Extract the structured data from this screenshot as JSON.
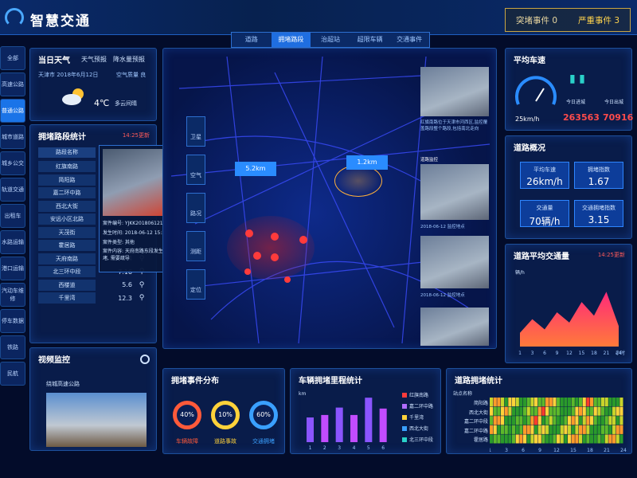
{
  "header": {
    "title": "智慧交通",
    "events": {
      "normal": "突堵事件 0",
      "severe": "严重事件 3"
    }
  },
  "tabs": [
    {
      "label": "道路"
    },
    {
      "label": "拥堵路段",
      "active": true
    },
    {
      "label": "治超站"
    },
    {
      "label": "超限车辆"
    },
    {
      "label": "交通事件"
    }
  ],
  "sidebar": {
    "items": [
      "全部",
      "高速公路",
      "普通公路",
      "城市道路",
      "城乡公交",
      "轨道交通",
      "出租车",
      "水路运输",
      "港口运输",
      "汽动车维修",
      "停车数据",
      "铁路",
      "民航"
    ],
    "active_index": 2
  },
  "weather": {
    "title": "当日天气",
    "tabs": [
      "天气预报",
      "降水量预报"
    ],
    "location_date": "天津市 2018年6月12日",
    "air": "空气质量 良",
    "temp": "4℃",
    "desc": "多云间晴"
  },
  "congestion_table": {
    "title": "拥堵路段统计",
    "updated": "14:25更新",
    "header": "路段名称",
    "rows": [
      {
        "name": "红旗南路"
      },
      {
        "name": "简阳路"
      },
      {
        "name": "嘉二环中路"
      },
      {
        "name": "西北大街"
      },
      {
        "name": "安远小区北路"
      },
      {
        "name": "天茂街"
      },
      {
        "name": "霍居路"
      },
      {
        "name": "天府南路",
        "value": "9.4"
      },
      {
        "name": "北三环中段",
        "value": "7.16"
      },
      {
        "name": "西楼道",
        "value": "5.6"
      },
      {
        "name": "千里湾",
        "value": "12.3"
      }
    ]
  },
  "popup": {
    "id": "案件编号: YJKK20180612152G",
    "time": "发生时间: 2018-06-12 15:26:25",
    "type": "案件类型: 其他",
    "content": "案件内容: 天府南路东段发生紧急拥堵, 需要疏导"
  },
  "video": {
    "title": "视频监控",
    "road": "绕城高速公路"
  },
  "map": {
    "tools": [
      "卫星",
      "空气",
      "路况",
      "测距",
      "定位"
    ],
    "labels": [
      "5.2km",
      "1.2km"
    ]
  },
  "camera_feed": {
    "caption1": "红旗南路位于天津市河西区,监控覆盖路段整个路段,包括南北走向",
    "title2": "道路监控",
    "caption2": "2018-06-12 监控地点",
    "caption3": "2018-06-12 监控地点",
    "caption4": "2018-06-12 监控地点"
  },
  "speed": {
    "title": "平均车速",
    "value": "25km/h",
    "today_label": "今日进城",
    "today_out_label": "今日出城",
    "in": "263563",
    "out": "70916"
  },
  "overview": {
    "title": "道路概况",
    "kpis": [
      {
        "label": "平均车速",
        "value": "26km/h"
      },
      {
        "label": "拥堵指数",
        "value": "1.67"
      },
      {
        "label": "交通量",
        "value": "70辆/h"
      },
      {
        "label": "交通拥堵指数",
        "value": "3.15"
      }
    ]
  },
  "events_dist": {
    "title": "拥堵事件分布",
    "items": [
      {
        "label": "车辆故障",
        "value": "40%",
        "color": "#ff5a3a"
      },
      {
        "label": "道路事故",
        "value": "10%",
        "color": "#ffd23a"
      },
      {
        "label": "交通拥堵",
        "value": "60%",
        "color": "#3aa0ff"
      }
    ]
  },
  "colors": {
    "panel": "#0a2050",
    "accent": "#1f6ee0",
    "danger": "#ff3b3b"
  },
  "chart_data": [
    {
      "type": "area",
      "title": "道路平均交通量",
      "updated": "14:25更新",
      "ylabel": "辆/h",
      "x": [
        1,
        3,
        6,
        9,
        12,
        15,
        18,
        21,
        24
      ],
      "xlabel_unit": "小时",
      "values": [
        40,
        80,
        50,
        100,
        70,
        130,
        90,
        160,
        60
      ],
      "ylim": [
        0,
        200
      ]
    },
    {
      "type": "bar",
      "title": "车辆拥堵里程统计",
      "ylabel": "km",
      "categories": [
        "1",
        "2",
        "3",
        "4",
        "5",
        "6"
      ],
      "series": [
        {
          "name": "",
          "values": [
            50,
            55,
            70,
            55,
            90,
            68
          ]
        }
      ],
      "ylim": [
        0,
        100
      ],
      "legend": [
        "红旗南路",
        "嘉二环中路",
        "千里湾",
        "西北大街",
        "北三环中段"
      ],
      "legend_colors": [
        "#ff3b3b",
        "#b06cff",
        "#ffd23a",
        "#3aa0ff",
        "#2ad1c9"
      ]
    },
    {
      "type": "heatmap",
      "title": "道路拥堵统计",
      "row_title": "站点名称",
      "rows": [
        "简阳路",
        "西北大街",
        "嘉二环中段",
        "嘉二环中路",
        "霍居路"
      ],
      "x_ticks": [
        "1",
        "3",
        "6",
        "9",
        "12",
        "15",
        "18",
        "21",
        "24"
      ],
      "x_unit": "小时"
    }
  ]
}
